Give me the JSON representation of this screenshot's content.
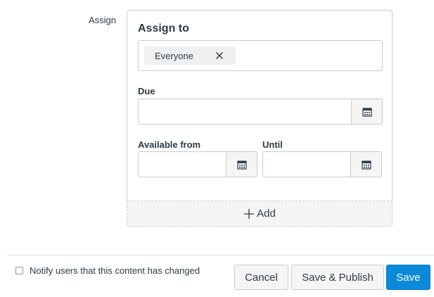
{
  "assign": {
    "section_label": "Assign",
    "card_title": "Assign to",
    "chips": [
      {
        "label": "Everyone"
      }
    ],
    "due_label": "Due",
    "available_from_label": "Available from",
    "until_label": "Until",
    "due_value": "",
    "available_from_value": "",
    "until_value": "",
    "add_label": "Add",
    "icons": {
      "remove": "close-icon",
      "calendar": "calendar-icon",
      "add": "plus-icon"
    }
  },
  "footer": {
    "notify_label": "Notify users that this content has changed",
    "notify_checked": false,
    "cancel_label": "Cancel",
    "save_publish_label": "Save & Publish",
    "save_label": "Save"
  },
  "colors": {
    "primary": "#0b8ada",
    "border": "#c7cdd1",
    "text": "#2d3b45"
  }
}
